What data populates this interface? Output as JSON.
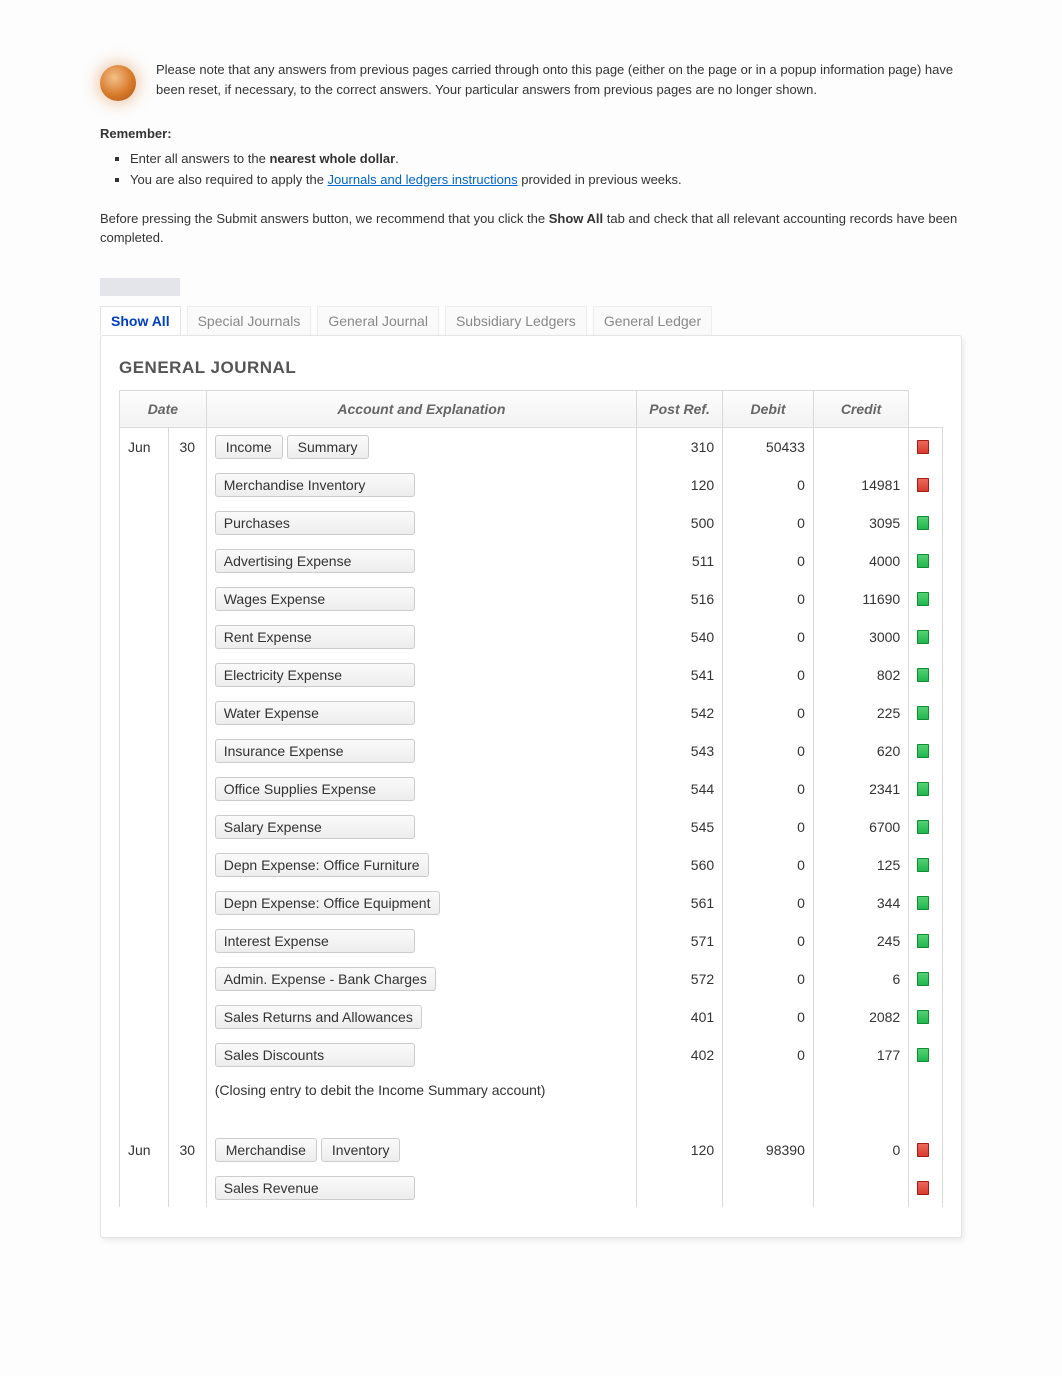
{
  "notice": "Please note that any answers from previous pages carried through onto this page (either on the page or in a popup information page) have been reset, if necessary, to the correct answers. Your particular answers from previous pages are no longer shown.",
  "remember_label": "Remember:",
  "remember_items": {
    "item1_pre": "Enter all answers to the ",
    "item1_bold": "nearest whole dollar",
    "item1_post": ".",
    "item2_pre": "You are also required to apply the ",
    "item2_link": "Journals and ledgers instructions",
    "item2_post": " provided in previous weeks."
  },
  "before_text_pre": "Before pressing the Submit answers button, we recommend that you click the ",
  "before_text_bold": "Show All",
  "before_text_post": " tab and check that all relevant accounting records have been completed.",
  "tabs": {
    "show_all": "Show All",
    "special_journals": "Special Journals",
    "general_journal": "General Journal",
    "subsidiary_ledgers": "Subsidiary Ledgers",
    "general_ledger": "General Ledger"
  },
  "section_title": "GENERAL JOURNAL",
  "headers": {
    "date": "Date",
    "account": "Account and Explanation",
    "post_ref": "Post Ref.",
    "debit": "Debit",
    "credit": "Credit"
  },
  "entries": [
    {
      "month": "Jun",
      "day": "30",
      "account_primary": "Income",
      "account_secondary": "Summary",
      "ref": "310",
      "debit": "50433",
      "credit": "",
      "flag": "bad",
      "indent": false
    },
    {
      "account": "Merchandise Inventory",
      "ref": "120",
      "debit": "0",
      "credit": "14981",
      "flag": "bad",
      "indent": true,
      "input_look": true
    },
    {
      "account": "Purchases",
      "ref": "500",
      "debit": "0",
      "credit": "3095",
      "flag": "ok",
      "indent": true,
      "input_look": true
    },
    {
      "account": "Advertising Expense",
      "ref": "511",
      "debit": "0",
      "credit": "4000",
      "flag": "ok",
      "indent": true,
      "input_look": true
    },
    {
      "account": "Wages Expense",
      "ref": "516",
      "debit": "0",
      "credit": "11690",
      "flag": "ok",
      "indent": true,
      "input_look": true
    },
    {
      "account": "Rent Expense",
      "ref": "540",
      "debit": "0",
      "credit": "3000",
      "flag": "ok",
      "indent": true,
      "input_look": true
    },
    {
      "account": "Electricity Expense",
      "ref": "541",
      "debit": "0",
      "credit": "802",
      "flag": "ok",
      "indent": true,
      "input_look": true
    },
    {
      "account": "Water Expense",
      "ref": "542",
      "debit": "0",
      "credit": "225",
      "flag": "ok",
      "indent": true,
      "input_look": true
    },
    {
      "account": "Insurance Expense",
      "ref": "543",
      "debit": "0",
      "credit": "620",
      "flag": "ok",
      "indent": true,
      "input_look": true
    },
    {
      "account": "Office Supplies Expense",
      "ref": "544",
      "debit": "0",
      "credit": "2341",
      "flag": "ok",
      "indent": true,
      "input_look": true
    },
    {
      "account": "Salary Expense",
      "ref": "545",
      "debit": "0",
      "credit": "6700",
      "flag": "ok",
      "indent": true,
      "input_look": true
    },
    {
      "account": "Depn Expense: Office Furniture",
      "ref": "560",
      "debit": "0",
      "credit": "125",
      "flag": "ok",
      "indent": true,
      "input_look": true
    },
    {
      "account": "Depn Expense: Office Equipment",
      "ref": "561",
      "debit": "0",
      "credit": "344",
      "flag": "ok",
      "indent": true,
      "input_look": true
    },
    {
      "account": "Interest Expense",
      "ref": "571",
      "debit": "0",
      "credit": "245",
      "flag": "ok",
      "indent": true,
      "input_look": true
    },
    {
      "account": "Admin. Expense - Bank Charges",
      "ref": "572",
      "debit": "0",
      "credit": "6",
      "flag": "ok",
      "indent": true,
      "input_look": true
    },
    {
      "account": "Sales Returns and Allowances",
      "ref": "401",
      "debit": "0",
      "credit": "2082",
      "flag": "ok",
      "indent": true,
      "input_look": true
    },
    {
      "account": "Sales Discounts",
      "ref": "402",
      "debit": "0",
      "credit": "177",
      "flag": "ok",
      "indent": true,
      "input_look": true
    },
    {
      "narration": "(Closing entry to debit the Income Summary account)"
    }
  ],
  "entries2": [
    {
      "month": "Jun",
      "day": "30",
      "account_primary": "Merchandise",
      "account_secondary": "Inventory",
      "ref": "120",
      "debit": "98390",
      "credit": "0",
      "flag": "bad",
      "indent": false
    },
    {
      "account": "Sales Revenue",
      "ref": "",
      "debit": "",
      "credit": "",
      "flag": "bad",
      "indent": true,
      "input_look": true
    }
  ]
}
